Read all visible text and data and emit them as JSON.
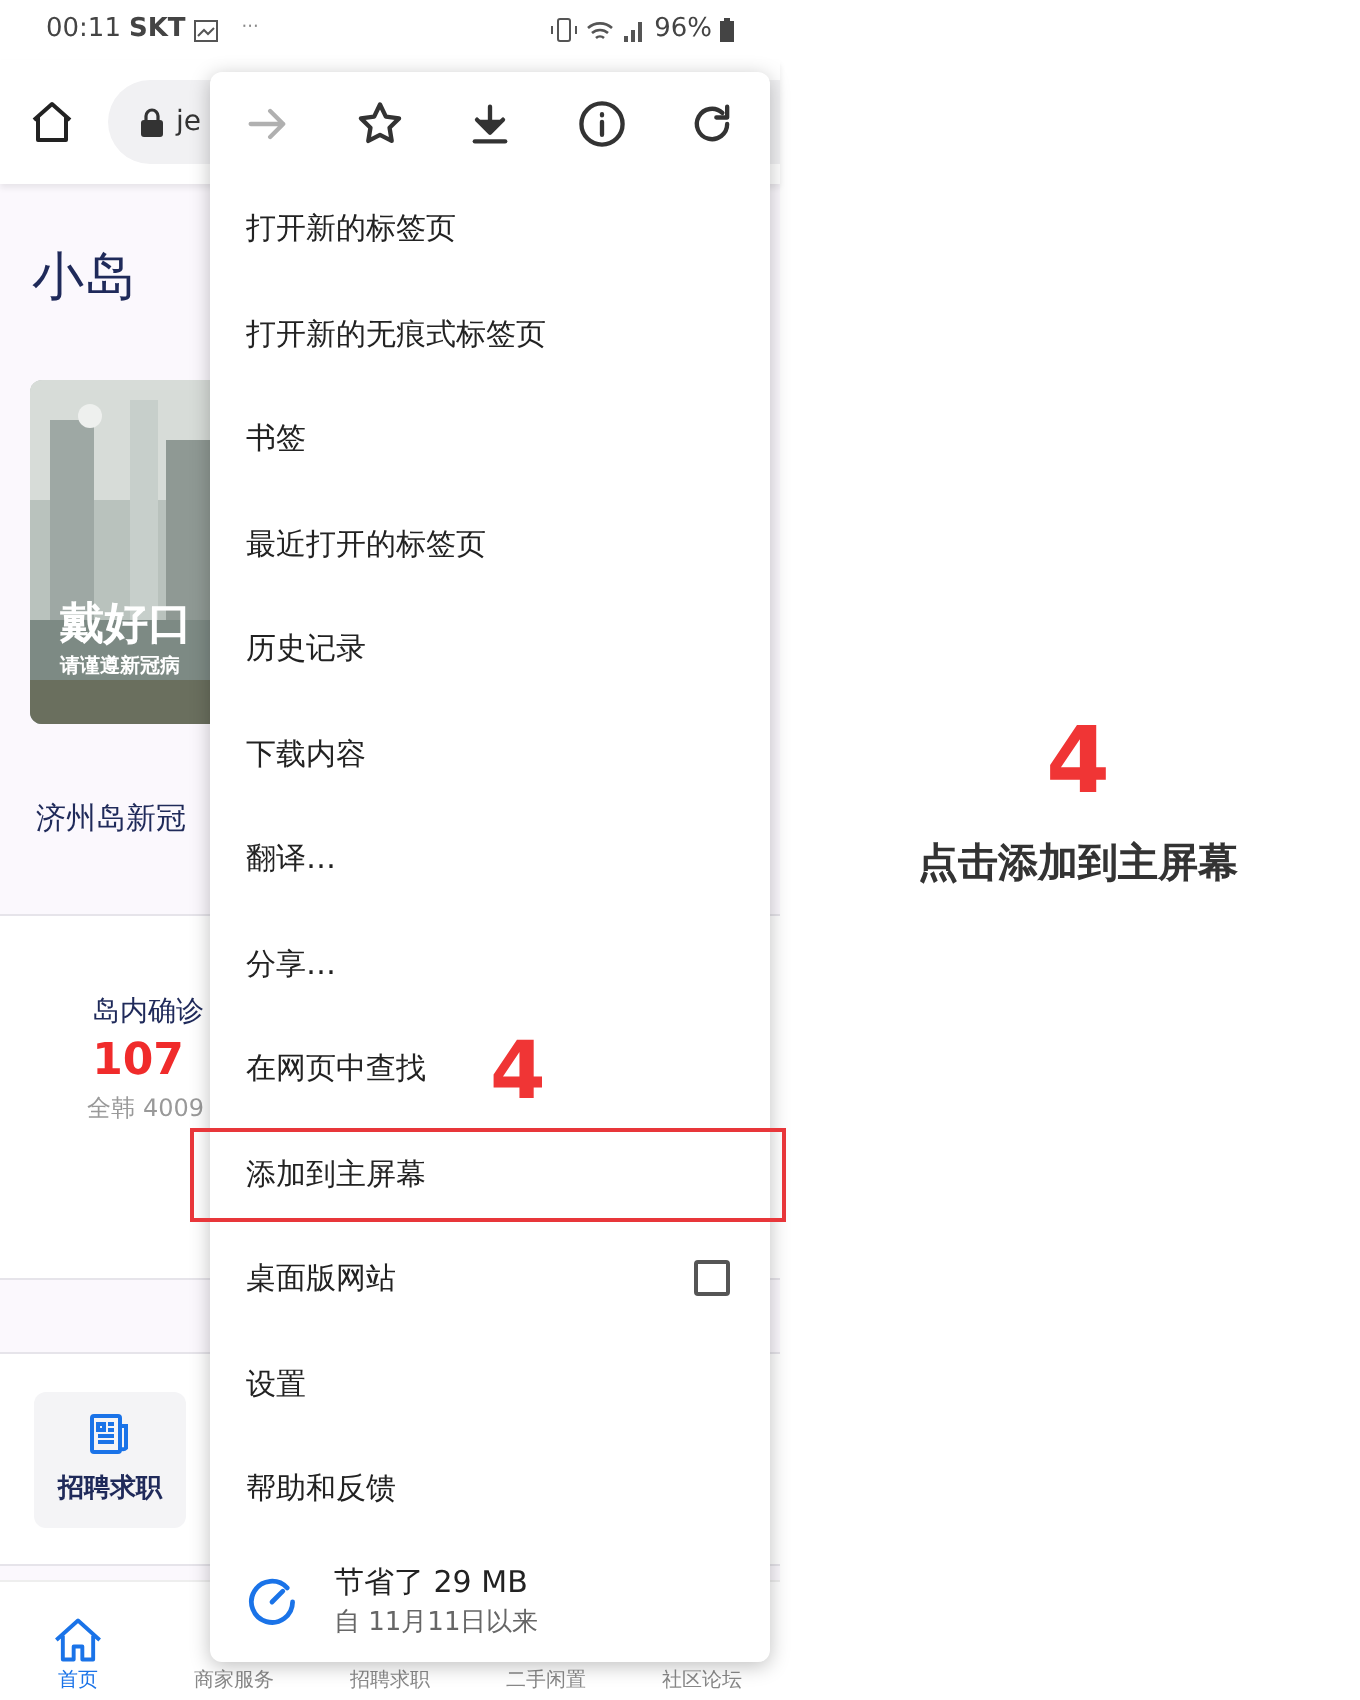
{
  "status_bar": {
    "time": "00:11",
    "carrier": "SKT",
    "more": "···",
    "battery": "96%"
  },
  "browser": {
    "url": "je"
  },
  "page": {
    "title": "小岛",
    "banner": {
      "kind": "picture",
      "headline": "戴好口",
      "subline": "请谨遵新冠病"
    },
    "news_line": "济州岛新冠",
    "stat": {
      "label": "岛内确诊",
      "value": "107",
      "sub": "全韩 4009"
    },
    "service_card": {
      "label": "招聘求职"
    }
  },
  "bottom_nav": [
    {
      "label": "首页",
      "selected": true
    },
    {
      "label": "商家服务",
      "selected": false
    },
    {
      "label": "招聘求职",
      "selected": false
    },
    {
      "label": "二手闲置",
      "selected": false
    },
    {
      "label": "社区论坛",
      "selected": false
    }
  ],
  "menu": {
    "actions": [
      {
        "kind": "forward",
        "disabled": true
      },
      {
        "kind": "bookmark",
        "disabled": false
      },
      {
        "kind": "download",
        "disabled": false
      },
      {
        "kind": "info",
        "disabled": false
      },
      {
        "kind": "reload",
        "disabled": false
      }
    ],
    "items": [
      {
        "kind": "plain",
        "label": "打开新的标签页",
        "highlighted": false
      },
      {
        "kind": "plain",
        "label": "打开新的无痕式标签页",
        "highlighted": false
      },
      {
        "kind": "plain",
        "label": "书签",
        "highlighted": false
      },
      {
        "kind": "plain",
        "label": "最近打开的标签页",
        "highlighted": false
      },
      {
        "kind": "plain",
        "label": "历史记录",
        "highlighted": false
      },
      {
        "kind": "plain",
        "label": "下载内容",
        "highlighted": false
      },
      {
        "kind": "plain",
        "label": "翻译…",
        "highlighted": false
      },
      {
        "kind": "plain",
        "label": "分享…",
        "highlighted": false
      },
      {
        "kind": "plain",
        "label": "在网页中查找",
        "highlighted": false
      },
      {
        "kind": "plain",
        "label": "添加到主屏幕",
        "highlighted": true
      },
      {
        "kind": "checkbox",
        "label": "桌面版网站",
        "checked": false,
        "highlighted": false
      },
      {
        "kind": "plain",
        "label": "设置",
        "highlighted": false
      },
      {
        "kind": "plain",
        "label": "帮助和反馈",
        "highlighted": false
      }
    ],
    "savings": {
      "title": "节省了 29 MB",
      "subtitle": "自 11月11日以来"
    }
  },
  "annotation": {
    "step": "4",
    "step_in_menu": "4",
    "caption": "点击添加到主屏幕"
  }
}
